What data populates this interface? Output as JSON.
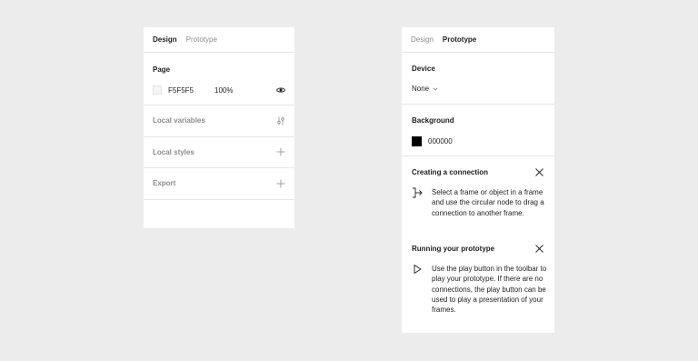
{
  "design_panel": {
    "tabs": [
      "Design",
      "Prototype"
    ],
    "page": {
      "title": "Page",
      "color_hex": "F5F5F5",
      "opacity": "100%"
    },
    "sections": [
      {
        "label": "Local variables",
        "icon": "sliders-icon"
      },
      {
        "label": "Local styles",
        "icon": "plus-icon"
      },
      {
        "label": "Export",
        "icon": "plus-icon"
      }
    ]
  },
  "prototype_panel": {
    "tabs": [
      "Design",
      "Prototype"
    ],
    "device": {
      "title": "Device",
      "value": "None"
    },
    "background": {
      "title": "Background",
      "color_hex": "000000"
    },
    "help": [
      {
        "title": "Creating a connection",
        "text": "Select a frame or object in a frame and use the circular node to drag a connection to another frame.",
        "icon": "connection-icon"
      },
      {
        "title": "Running your prototype",
        "text": "Use the play button in the toolbar to play your prototype. If there are no connections, the play button can be used to play a presentation of your frames.",
        "icon": "play-icon"
      }
    ]
  },
  "colors": {
    "page_swatch": "#F5F5F5",
    "background_swatch": "#000000",
    "canvas": "#ECECEC"
  }
}
